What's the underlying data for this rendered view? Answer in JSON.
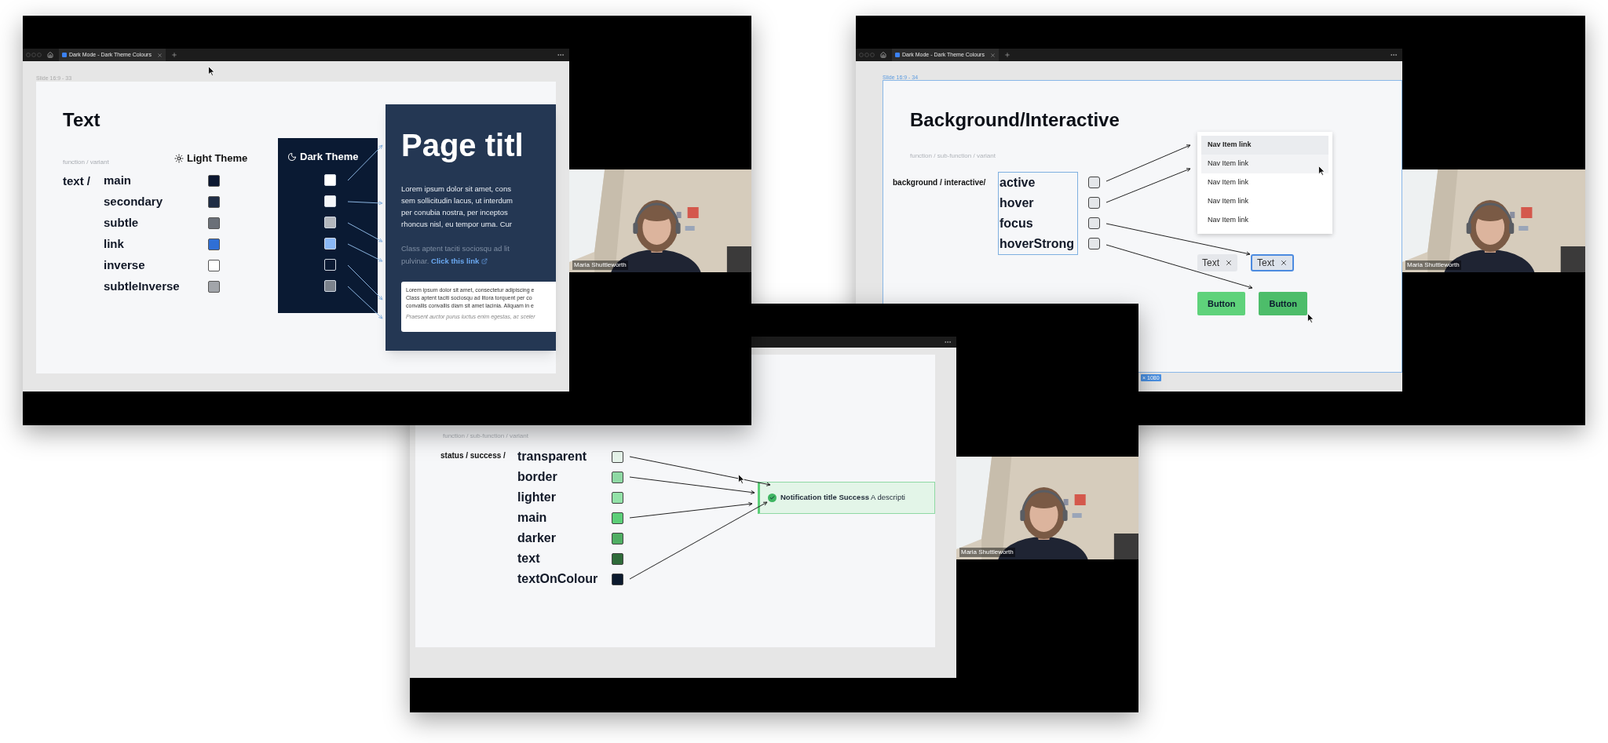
{
  "text_window": {
    "tab_title": "Dark Mode - Dark Theme Colours",
    "slide_label": "Slide 16:9 - 33",
    "title": "Text",
    "hint": "function / variant",
    "light_theme": "Light Theme",
    "dark_theme": "Dark Theme",
    "rows": [
      {
        "prefix": "text /",
        "label": "main",
        "color": "#0b1730",
        "dark": {
          "color": "#ffffff"
        }
      },
      {
        "label": "secondary",
        "color": "#1f2d45",
        "dark": {
          "color": "#f4f6f9"
        }
      },
      {
        "label": "subtle",
        "color": "#6b7078",
        "dark": {
          "color": "#b3b7bd"
        }
      },
      {
        "label": "link",
        "color": "#2f6fd6",
        "dark": {
          "color": "#8ab8f5"
        }
      },
      {
        "label": "inverse",
        "color": "#ffffff",
        "dark": {
          "color": "#0b1a33"
        }
      },
      {
        "label": "subtleInverse",
        "color": "#a2a5aa",
        "dark": {
          "color": "#7b828c"
        }
      }
    ],
    "card": {
      "heading": "Page titl",
      "body_lines": [
        "Lorem ipsum dolor sit amet, cons",
        "sem sollicitudin lacus, ut interdum",
        "per conubia nostra, per inceptos",
        "rhoncus nisl, eu tempor urna. Cur"
      ],
      "subtle_lines": [
        "Class aptent taciti sociosqu ad lit",
        "pulvinar."
      ],
      "link": "Click this link",
      "inner_lines": [
        "Lorem ipsum dolor sit amet, consectetur adipiscing e",
        "Class aptent taciti sociosqu ad litora torquent per co",
        "convallis convallis diam sit amet lacinia. Aliquam in e"
      ],
      "inner_caption": "Praesent auctor purus luctus enim egestas, ac sceler"
    },
    "video_name": "Maria Shuttleworth"
  },
  "interactive_window": {
    "tab_title": "Dark Mode - Dark Theme Colours",
    "slide_label": "Slide 16:9 - 34",
    "size_label": "× 1080",
    "title": "Background/Interactive",
    "hint": "function / sub-function / variant",
    "prefix": "background / interactive/",
    "variants": [
      "active",
      "hover",
      "focus",
      "hoverStrong"
    ],
    "nav_items": [
      {
        "label": "Nav Item link",
        "selected": true,
        "hovered": false
      },
      {
        "label": "Nav Item link",
        "selected": false,
        "hovered": true
      },
      {
        "label": "Nav Item link",
        "selected": false,
        "hovered": false
      },
      {
        "label": "Nav Item link",
        "selected": false,
        "hovered": false
      },
      {
        "label": "Nav Item link",
        "selected": false,
        "hovered": false
      }
    ],
    "chips": [
      {
        "label": "Text",
        "focused": false
      },
      {
        "label": "Text",
        "focused": true
      }
    ],
    "buttons": [
      {
        "label": "Button",
        "hovered": false
      },
      {
        "label": "Button",
        "hovered": true
      }
    ],
    "video_name": "Maria Shuttleworth"
  },
  "status_window": {
    "hint": "function / sub-function / variant",
    "prefix": "status / success /",
    "variants": [
      {
        "label": "transparent",
        "color": "#e6f4ea"
      },
      {
        "label": "border",
        "color": "#8fd9a4"
      },
      {
        "label": "lighter",
        "color": "#93e2a8"
      },
      {
        "label": "main",
        "color": "#5ccf78"
      },
      {
        "label": "darker",
        "color": "#4fae63"
      },
      {
        "label": "text",
        "color": "#2f6b3a"
      },
      {
        "label": "textOnColour",
        "color": "#0c1a2e"
      }
    ],
    "notification": {
      "text": "**Notification title Success** A descripti"
    },
    "video_name": "Maria Shuttleworth"
  }
}
